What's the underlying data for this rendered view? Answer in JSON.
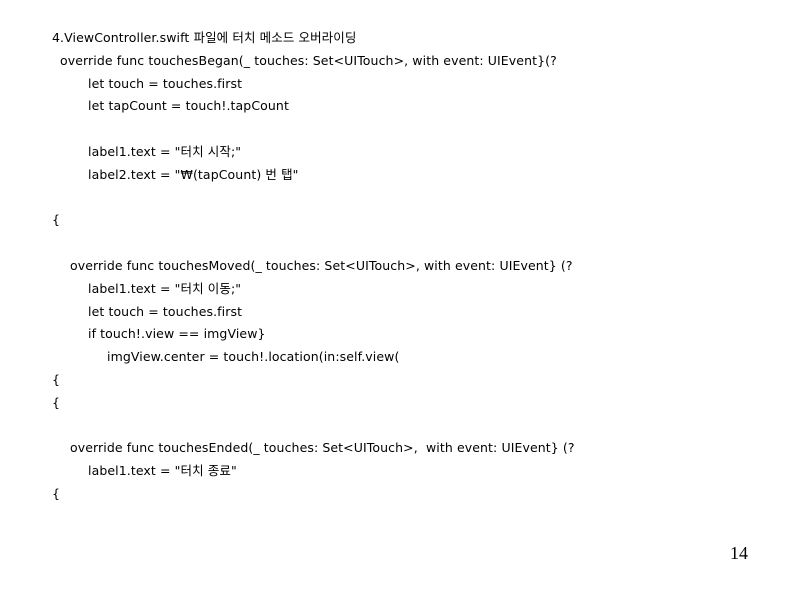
{
  "slide": {
    "heading": "4.ViewController.swift 파일에 터치 메소드 오버라이딩",
    "code_lines": [
      "override func touchesBegan(_ touches: Set<UITouch>, with event: UIEvent}(?",
      "let touch = touches.first",
      "let tapCount = touch!.tapCount",
      "label1.text = \"터치 시작;\"",
      "label2.text = \"₩(tapCount) 번 탭\"",
      "{",
      "override func touchesMoved(_ touches: Set<UITouch>, with event: UIEvent} (?",
      "label1.text = \"터치 이동;\"",
      "let touch = touches.first",
      "if touch!.view == imgView}",
      "imgView.center = touch!.location(in:self.view(",
      "{",
      "{",
      "override func touchesEnded(_ touches: Set<UITouch>,  with event: UIEvent} (?",
      "label1.text = \"터치 종료\"",
      "{"
    ],
    "page_number": "14"
  }
}
